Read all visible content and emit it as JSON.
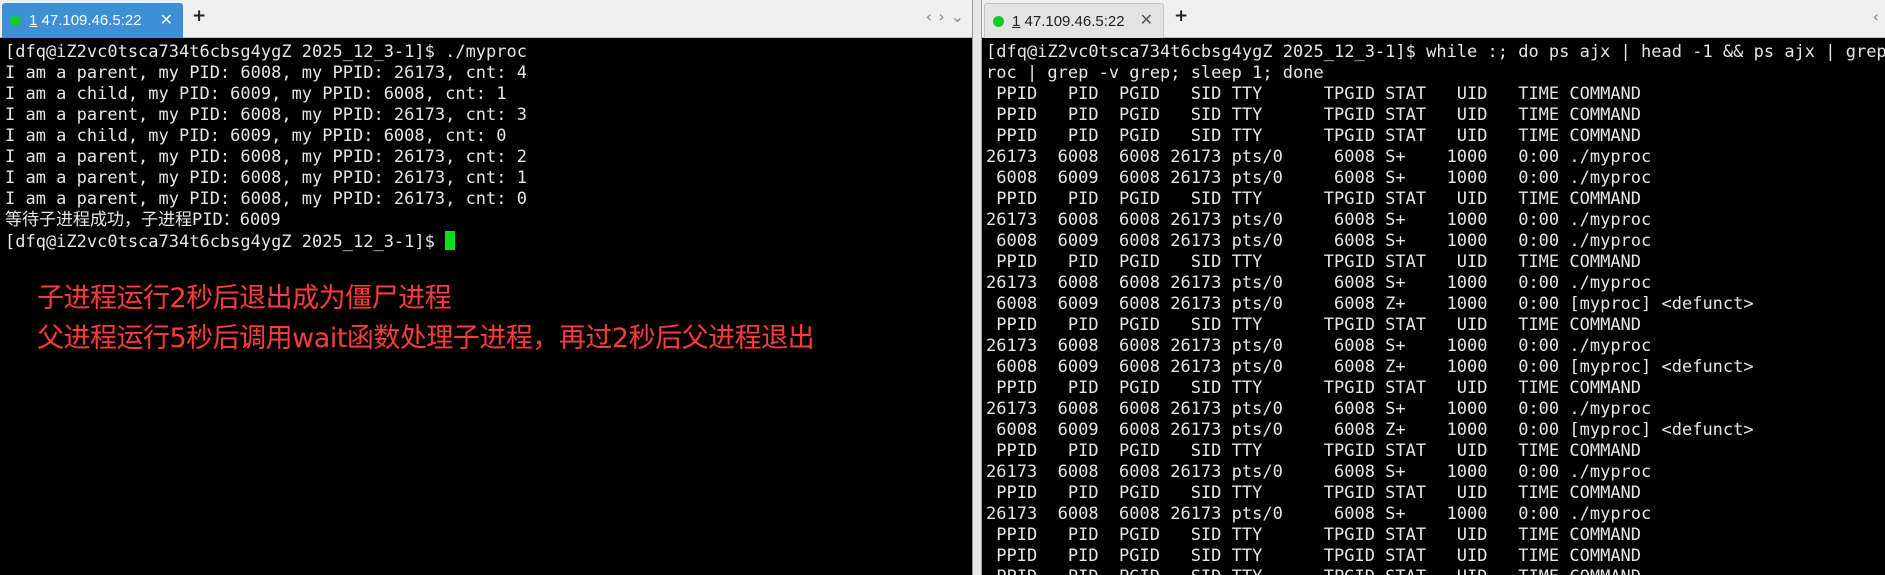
{
  "left_tab": {
    "index": "1",
    "title": " 47.109.46.5:22",
    "close": "✕"
  },
  "right_tab": {
    "index": "1",
    "title": " 47.109.46.5:22",
    "close": "✕"
  },
  "new_tab": "+",
  "nav": {
    "prev": "‹",
    "next": "›",
    "menu": "⌄"
  },
  "colors": {
    "active_tab": "#3d8fd6",
    "status_dot": "#18c82e",
    "cursor": "#00e21e",
    "annotation": "#ff3b3b",
    "terminal_bg": "#000000",
    "terminal_fg": "#e6e6e6"
  },
  "left_terminal": {
    "lines": [
      "[dfq@iZ2vc0tsca734t6cbsg4ygZ 2025_12_3-1]$ ./myproc",
      "I am a parent, my PID: 6008, my PPID: 26173, cnt: 4",
      "I am a child, my PID: 6009, my PPID: 6008, cnt: 1",
      "I am a parent, my PID: 6008, my PPID: 26173, cnt: 3",
      "I am a child, my PID: 6009, my PPID: 6008, cnt: 0",
      "I am a parent, my PID: 6008, my PPID: 26173, cnt: 2",
      "I am a parent, my PID: 6008, my PPID: 26173, cnt: 1",
      "I am a parent, my PID: 6008, my PPID: 26173, cnt: 0",
      "等待子进程成功，子进程PID：6009"
    ],
    "prompt": "[dfq@iZ2vc0tsca734t6cbsg4ygZ 2025_12_3-1]$ "
  },
  "annotations": [
    "子进程运行2秒后退出成为僵尸进程",
    "父进程运行5秒后调用wait函数处理子进程，再过2秒后父进程退出"
  ],
  "right_terminal": {
    "lines": [
      "[dfq@iZ2vc0tsca734t6cbsg4ygZ 2025_12_3-1]$ while :; do ps ajx | head -1 && ps ajx | grep p",
      "roc | grep -v grep; sleep 1; done",
      " PPID   PID  PGID   SID TTY      TPGID STAT   UID   TIME COMMAND",
      " PPID   PID  PGID   SID TTY      TPGID STAT   UID   TIME COMMAND",
      " PPID   PID  PGID   SID TTY      TPGID STAT   UID   TIME COMMAND",
      "26173  6008  6008 26173 pts/0     6008 S+    1000   0:00 ./myproc",
      " 6008  6009  6008 26173 pts/0     6008 S+    1000   0:00 ./myproc",
      " PPID   PID  PGID   SID TTY      TPGID STAT   UID   TIME COMMAND",
      "26173  6008  6008 26173 pts/0     6008 S+    1000   0:00 ./myproc",
      " 6008  6009  6008 26173 pts/0     6008 S+    1000   0:00 ./myproc",
      " PPID   PID  PGID   SID TTY      TPGID STAT   UID   TIME COMMAND",
      "26173  6008  6008 26173 pts/0     6008 S+    1000   0:00 ./myproc",
      " 6008  6009  6008 26173 pts/0     6008 Z+    1000   0:00 [myproc] <defunct>",
      " PPID   PID  PGID   SID TTY      TPGID STAT   UID   TIME COMMAND",
      "26173  6008  6008 26173 pts/0     6008 S+    1000   0:00 ./myproc",
      " 6008  6009  6008 26173 pts/0     6008 Z+    1000   0:00 [myproc] <defunct>",
      " PPID   PID  PGID   SID TTY      TPGID STAT   UID   TIME COMMAND",
      "26173  6008  6008 26173 pts/0     6008 S+    1000   0:00 ./myproc",
      " 6008  6009  6008 26173 pts/0     6008 Z+    1000   0:00 [myproc] <defunct>",
      " PPID   PID  PGID   SID TTY      TPGID STAT   UID   TIME COMMAND",
      "26173  6008  6008 26173 pts/0     6008 S+    1000   0:00 ./myproc",
      " PPID   PID  PGID   SID TTY      TPGID STAT   UID   TIME COMMAND",
      "26173  6008  6008 26173 pts/0     6008 S+    1000   0:00 ./myproc",
      " PPID   PID  PGID   SID TTY      TPGID STAT   UID   TIME COMMAND",
      " PPID   PID  PGID   SID TTY      TPGID STAT   UID   TIME COMMAND",
      " PPID   PID  PGID   SID TTY      TPGID STAT   UID   TIME COMMAND"
    ]
  }
}
